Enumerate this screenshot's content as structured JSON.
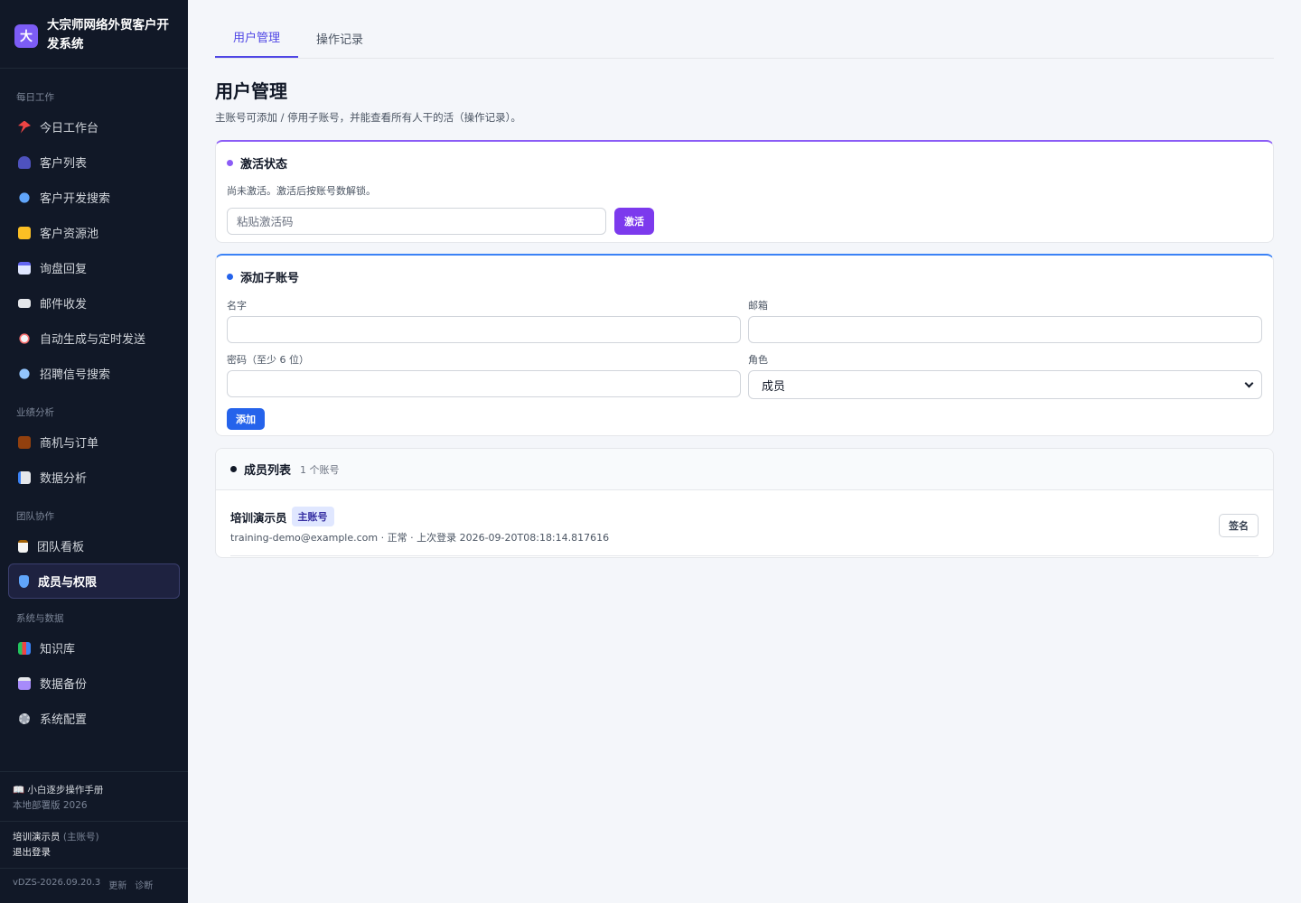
{
  "sidebar": {
    "brand_logo": "大",
    "brand_name": "大宗师网络外贸客户开发系统",
    "groups": [
      {
        "label": "每日工作",
        "items": [
          {
            "label": "今日工作台",
            "icon": "pin-icon"
          },
          {
            "label": "客户列表",
            "icon": "users-icon"
          },
          {
            "label": "客户开发搜索",
            "icon": "search-icon"
          },
          {
            "label": "客户资源池",
            "icon": "folder-icon"
          },
          {
            "label": "询盘回复",
            "icon": "calendar-icon"
          },
          {
            "label": "邮件收发",
            "icon": "mail-icon"
          },
          {
            "label": "自动生成与定时发送",
            "icon": "alarm-icon"
          },
          {
            "label": "招聘信号搜索",
            "icon": "magnifier-icon"
          }
        ]
      },
      {
        "label": "业绩分析",
        "items": [
          {
            "label": "商机与订单",
            "icon": "briefcase-icon"
          },
          {
            "label": "数据分析",
            "icon": "chart-icon"
          }
        ]
      },
      {
        "label": "团队协作",
        "items": [
          {
            "label": "团队看板",
            "icon": "clipboard-icon"
          },
          {
            "label": "成员与权限",
            "icon": "shield-icon",
            "active": true
          }
        ]
      },
      {
        "label": "系统与数据",
        "items": [
          {
            "label": "知识库",
            "icon": "books-icon"
          },
          {
            "label": "数据备份",
            "icon": "floppy-icon"
          },
          {
            "label": "系统配置",
            "icon": "gear-icon"
          }
        ]
      }
    ],
    "manual_label": "📖 小白逐步操作手册",
    "manual_sub": "本地部署版 2026",
    "user_name": "培训演示员",
    "user_role": "(主账号)",
    "logout_label": "退出登录",
    "version": "vDZS-2026.09.20.3",
    "update_label": "更新",
    "diagnose_label": "诊断"
  },
  "tabs": [
    {
      "label": "用户管理",
      "active": true
    },
    {
      "label": "操作记录",
      "active": false
    }
  ],
  "page": {
    "title": "用户管理",
    "description": "主账号可添加 / 停用子账号，并能查看所有人干的活（操作记录）。"
  },
  "activation": {
    "title": "激活状态",
    "message": "尚未激活。激活后按账号数解锁。",
    "input_placeholder": "粘贴激活码",
    "button_label": "激活"
  },
  "add_account": {
    "title": "添加子账号",
    "name_label": "名字",
    "email_label": "邮箱",
    "password_label": "密码（至少 6 位）",
    "role_label": "角色",
    "role_value": "成员",
    "button_label": "添加"
  },
  "members": {
    "title": "成员列表",
    "count": "1 个账号",
    "rows": [
      {
        "name": "培训演示员",
        "badge": "主账号",
        "meta": "training-demo@example.com · 正常 · 上次登录 2026-09-20T08:18:14.817616",
        "action_label": "签名"
      }
    ]
  },
  "colors": {
    "sidebar_bg": "#111827",
    "accent_purple": "#7c3aed",
    "accent_blue": "#2563eb",
    "tab_active": "#4f46e5"
  }
}
